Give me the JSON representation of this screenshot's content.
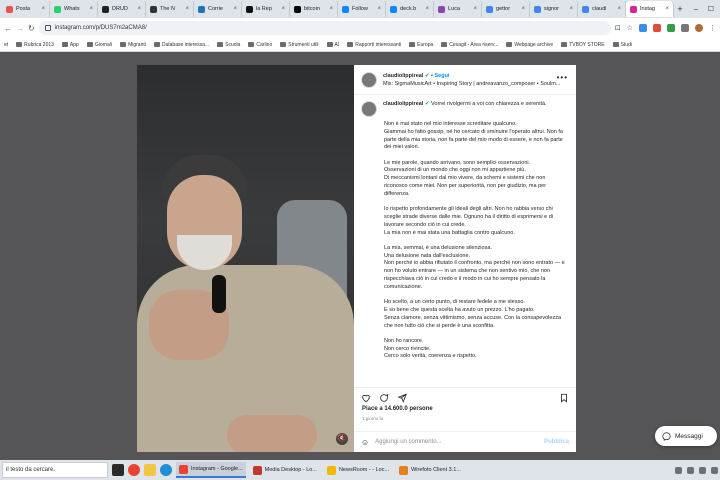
{
  "browser": {
    "tabs": [
      {
        "label": "Posta",
        "color": "#e8564b"
      },
      {
        "label": "Whats",
        "color": "#25d366"
      },
      {
        "label": "DRUD",
        "color": "#222222"
      },
      {
        "label": "The N",
        "color": "#333333"
      },
      {
        "label": "Corrie",
        "color": "#1e73be"
      },
      {
        "label": "la Rep",
        "color": "#111111"
      },
      {
        "label": "bitcoin",
        "color": "#000000"
      },
      {
        "label": "Follow",
        "color": "#1185fe"
      },
      {
        "label": "deck.b",
        "color": "#1185fe"
      },
      {
        "label": "Luca",
        "color": "#8e44ad"
      },
      {
        "label": "gettor",
        "color": "#4285f4"
      },
      {
        "label": "signor",
        "color": "#4285f4"
      },
      {
        "label": "claudi",
        "color": "#4285f4"
      },
      {
        "label": "Instag",
        "color": "#d6249f",
        "active": true
      }
    ],
    "new_tab": "+",
    "url": "instagram.com/p/DUS7m2aCMA8/",
    "bookmarks": [
      "et",
      "Rubrica 2013",
      "App",
      "Giornali",
      "Migranti",
      "Database interessa...",
      "Scuola",
      "Carlino",
      "Strumenti utili",
      "AI",
      "Rapporti interessanti",
      "Europa",
      "Cesagit - Area riserv...",
      "Webpage archive",
      "TVBOY STORE",
      "Studi"
    ]
  },
  "post": {
    "username": "claudiolippireal",
    "verified_icon": "verified-badge-icon",
    "separator": "•",
    "follow": "Segui",
    "audio": "Mix: SigmaMusicArt • Inspiring Story | andreavanzo_composer • Soulm...",
    "caption_first": "Vorrei rivolgermi a voi con chiarezza e serenità.",
    "paragraphs": [
      [
        "Non è mai stato nel mio interesse screditare qualcuno.",
        "Giammai ho fatto gossip, né ho cercato di sminuire l'operato altrui. Non fa parte della mia storia, non fa parte del mio modo di essere, e non fa parte dei miei valori."
      ],
      [
        "Le mie parole, quando arrivano, sono semplici osservazioni.",
        "Osservazioni di un mondo che oggi non mi appartiene più.",
        "Di meccanismi lontani dal mio vivere, da schemi e sistemi che non riconosco come miei. Non per superiorità, non per giudizio, ma per differenza."
      ],
      [
        "Io rispetto profondamente gli ideali degli altri. Non ho rabbia verso chi sceglie strade diverse dalle mie. Ognuno ha il diritto di esprimersi e di lavorare secondo ciò in cui crede.",
        "La mia non è mai stata una battaglia contro qualcuno."
      ],
      [
        "La mia, semmai, è una delusione silenziosa.",
        "Una delusione nata dall'esclusione.",
        "Non perché io abbia rifiutato il confronto, ma perché non sono entrato — e non ho voluto entrare — in un sistema che non sentivo mio, che non rispecchiava ciò in cui credo e il modo in cui ho sempre pensato la comunicazione."
      ],
      [
        "Ho scelto, a un certo punto, di restare fedele a me stesso.",
        "E so bene che questa scelta ha avuto un prezzo. L'ho pagato.",
        "Senza clamore, senza vittimismo, senza accuse. Con la consapevolezza che non tutto ciò che si perde è una sconfitta."
      ],
      [
        "Non ho rancore.",
        "Non cerco rivincite.",
        "Cerco solo verità, coerenza e rispetto."
      ]
    ],
    "likes": "Piace a 14.600.0 persone",
    "time_ago": "1 giorno fa",
    "comment_placeholder": "Aggiungi un commento...",
    "publish": "Pubblica"
  },
  "messages_label": "Messaggi",
  "taskbar": {
    "search_text": "il testo da cercare.",
    "apps": [
      {
        "label": "Instagram - Google...",
        "active": true,
        "color": "#e94235"
      },
      {
        "label": "Media Desktop - Lo...",
        "active": false,
        "color": "#c0392b"
      },
      {
        "label": "NewsRoom - - Loc...",
        "active": false,
        "color": "#f5b800"
      },
      {
        "label": "Wirefoto Client 3.1...",
        "active": false,
        "color": "#e67e22"
      }
    ]
  }
}
